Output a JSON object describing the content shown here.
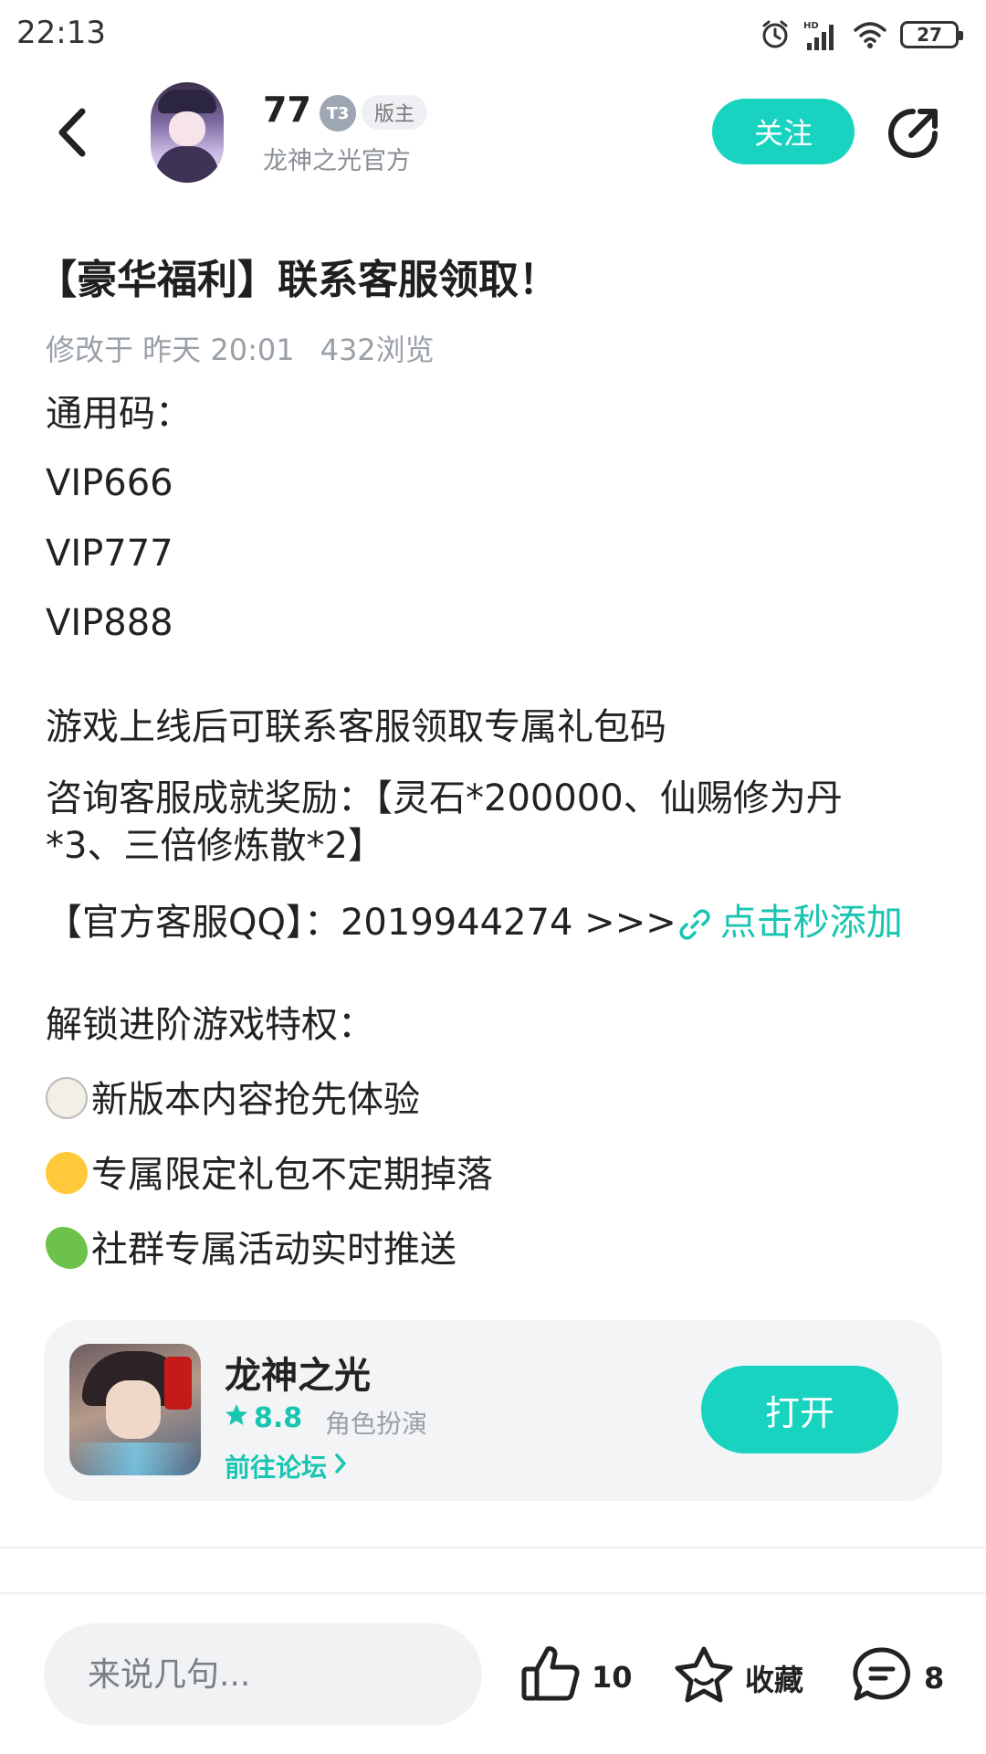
{
  "status_bar": {
    "time": "22:13",
    "battery": "27",
    "icons": [
      "alarm-icon",
      "hd-signal-icon",
      "wifi-icon",
      "battery-icon"
    ]
  },
  "header": {
    "user_name": "77",
    "level_badge": "T3",
    "mod_badge": "版主",
    "subtitle": "龙神之光官方",
    "follow_label": "关注"
  },
  "post": {
    "title": "【豪华福利】联系客服领取！",
    "modified": "修改于 昨天 20:01",
    "views": "432浏览",
    "lines": {
      "codes_label": "通用码：",
      "code1": "VIP666",
      "code2": "VIP777",
      "code3": "VIP888",
      "contact": "游戏上线后可联系客服领取专属礼包码",
      "reward_a": "咨询客服成就奖励：【灵石*200000、仙赐修为丹",
      "reward_b": "*3、三倍修炼散*2】",
      "qq_prefix": "【官方客服QQ】：2019944274 >>>",
      "qq_link": "点击秒添加",
      "unlock": "解锁进阶游戏特权：",
      "perk1": "新版本内容抢先体验",
      "perk2": "专属限定礼包不定期掉落",
      "perk3": "社群专属活动实时推送"
    }
  },
  "game_card": {
    "name": "龙神之光",
    "rating": "8.8",
    "genre": "角色扮演",
    "forum_link": "前往论坛",
    "open_label": "打开"
  },
  "bottom_bar": {
    "comment_placeholder": "来说几句...",
    "likes": "10",
    "favorite_label": "收藏",
    "comments": "8"
  },
  "colors": {
    "accent": "#18d3bf",
    "link": "#18c5b1",
    "muted": "#9aa0a7"
  }
}
